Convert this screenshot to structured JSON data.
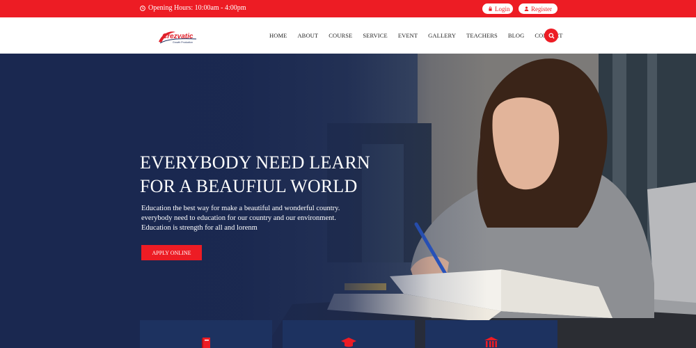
{
  "topbar": {
    "hours": "Opening Hours: 10:00am - 4:00pm",
    "login_label": "Login",
    "register_label": "Register"
  },
  "header": {
    "logo_text": "Crezvatic",
    "logo_tagline": "Growth Production",
    "nav": [
      "HOME",
      "ABOUT",
      "COURSE",
      "SERVICE",
      "EVENT",
      "GALLERY",
      "TEACHERS",
      "BLOG",
      "CONTACT"
    ]
  },
  "hero": {
    "title_line1": "EVERYBODY NEED LEARN",
    "title_line2": "FOR A BEAUFIUL WORLD",
    "text_line1": "Education the best way for make a beautiful and wonderful country.",
    "text_line2": "everybody need to education for our country and our environment.",
    "text_line3": "Education is strength for all and lorenm",
    "cta_label": "APPLY ONLINE"
  },
  "features": [
    {
      "icon": "book-icon"
    },
    {
      "icon": "graduation-cap-icon"
    },
    {
      "icon": "institution-icon"
    }
  ],
  "colors": {
    "accent": "#ed1c24",
    "navy": "#1a2a52"
  }
}
